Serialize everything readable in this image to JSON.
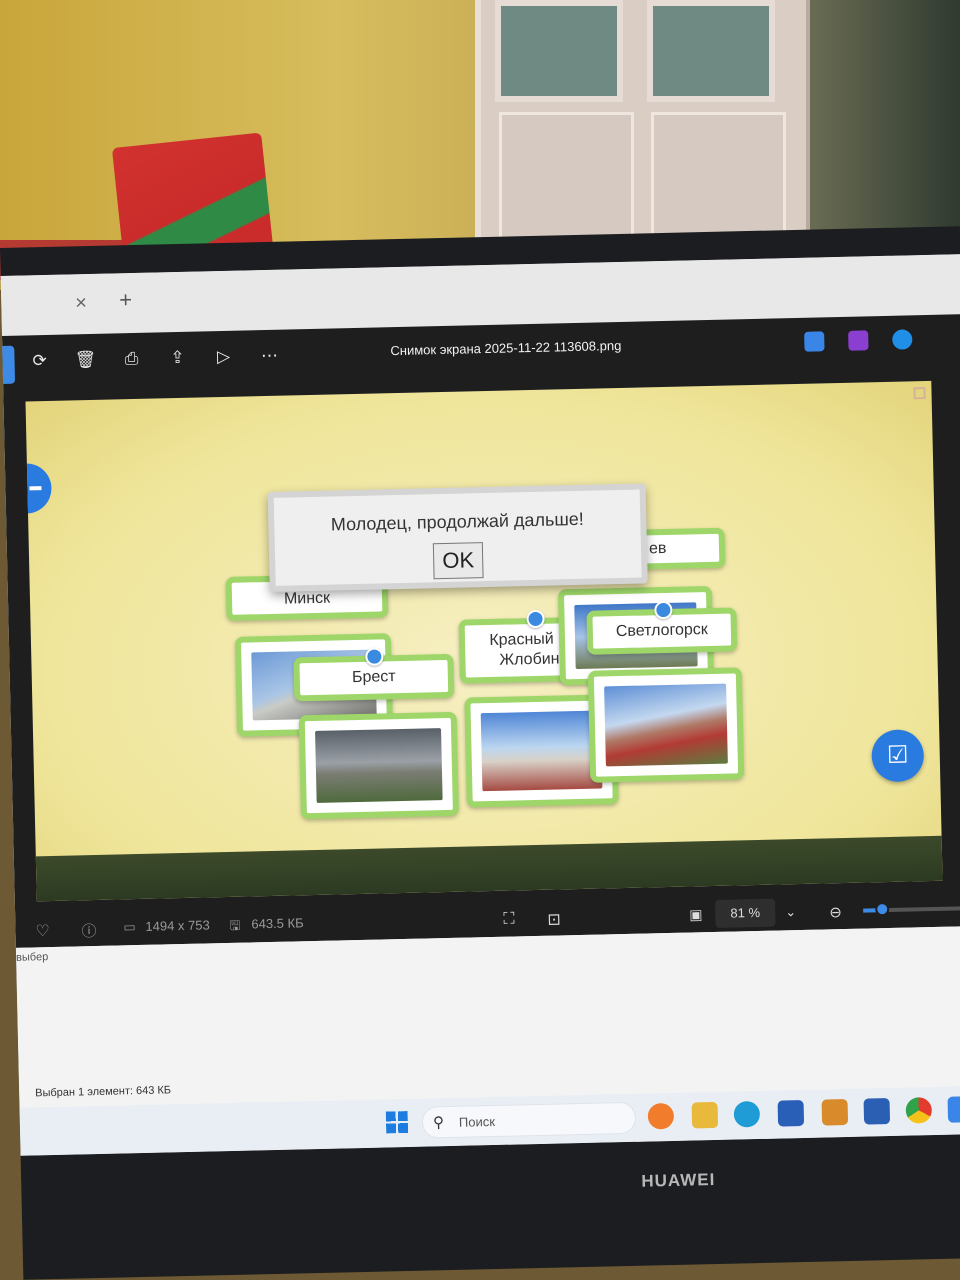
{
  "browser": {
    "tab_close": "×",
    "tab_new": "+"
  },
  "viewer": {
    "title": "Снимок экрана 2025-11-22 113608.png",
    "toolbar_icons": [
      "rotate-icon",
      "delete-icon",
      "print-icon",
      "share-icon",
      "slideshow-icon",
      "more-icon"
    ],
    "status": {
      "dimensions": "1494 x 753",
      "filesize": "643.5 КБ",
      "zoom": "81 %",
      "zoom_level_percent": 81
    }
  },
  "game": {
    "dialog_message": "Молодец, продолжай дальше!",
    "dialog_ok": "OK",
    "labels": {
      "minsk": "Минск",
      "brest": "Брест",
      "krasny": "Красный Б",
      "zhlobin": "Жлобин",
      "partial_right": "ев",
      "svetlogorsk": "Светлогорск"
    }
  },
  "explorer": {
    "partial_label": "выбер",
    "status": "Выбран 1 элемент: 643 КБ"
  },
  "taskbar": {
    "search_placeholder": "Поиск"
  },
  "laptop_brand": "HUAWEI"
}
